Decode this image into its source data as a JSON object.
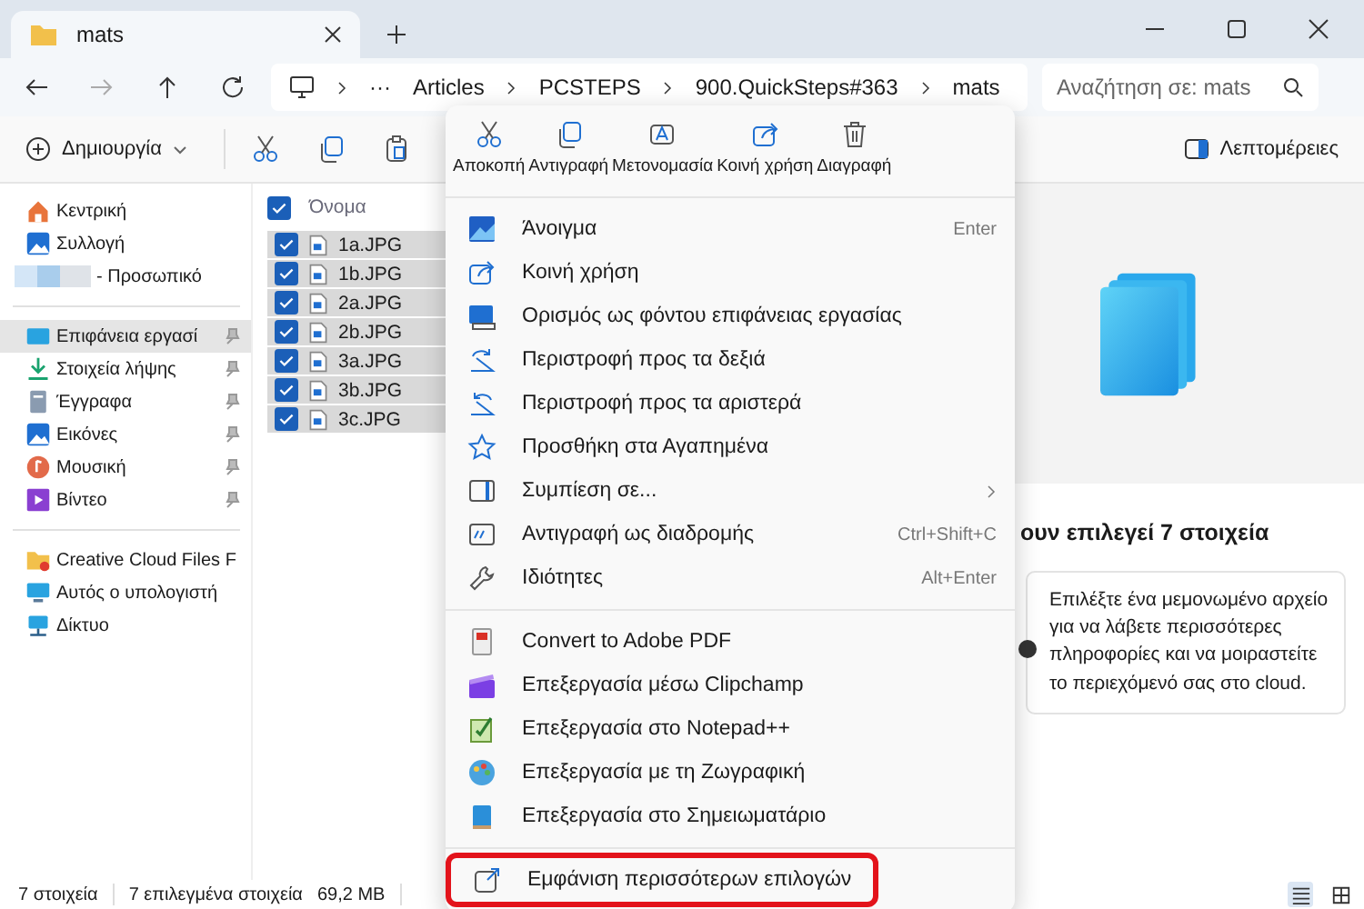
{
  "tabs": [
    {
      "title": "mats",
      "selected": true
    }
  ],
  "address": {
    "overflow": "···",
    "crumbs": [
      "Articles",
      "PCSTEPS",
      "900.QuickSteps#363",
      "mats"
    ]
  },
  "search": {
    "placeholder": "Αναζήτηση σε: mats"
  },
  "toolbar": {
    "new": "Δημιουργία",
    "details": "Λεπτομέρειες"
  },
  "sidebar": {
    "groups": [
      [
        {
          "label": "Κεντρική",
          "kind": "location",
          "pinned": false,
          "selected": false
        },
        {
          "label": "Συλλογή",
          "kind": "location",
          "pinned": false,
          "selected": false
        },
        {
          "label": "- Προσωπικό",
          "kind": "account",
          "pinned": false,
          "selected": false
        }
      ],
      [
        {
          "label": "Επιφάνεια εργασί",
          "kind": "location",
          "pinned": true,
          "selected": true
        },
        {
          "label": "Στοιχεία λήψης",
          "kind": "location",
          "pinned": true,
          "selected": false
        },
        {
          "label": "Έγγραφα",
          "kind": "location",
          "pinned": true,
          "selected": false
        },
        {
          "label": "Εικόνες",
          "kind": "location",
          "pinned": true,
          "selected": false
        },
        {
          "label": "Μουσική",
          "kind": "location",
          "pinned": true,
          "selected": false
        },
        {
          "label": "Βίντεο",
          "kind": "location",
          "pinned": true,
          "selected": false
        }
      ],
      [
        {
          "label": "Creative Cloud Files F",
          "kind": "location",
          "pinned": false,
          "selected": false
        },
        {
          "label": "Αυτός ο υπολογιστή",
          "kind": "location",
          "pinned": false,
          "selected": false
        },
        {
          "label": "Δίκτυο",
          "kind": "location",
          "pinned": false,
          "selected": false
        }
      ]
    ]
  },
  "files": {
    "header": "Όνομα",
    "header_checked": true,
    "rows": [
      {
        "name": "1a.JPG",
        "checked": true,
        "selected": true
      },
      {
        "name": "1b.JPG",
        "checked": true,
        "selected": true
      },
      {
        "name": "2a.JPG",
        "checked": true,
        "selected": true
      },
      {
        "name": "2b.JPG",
        "checked": true,
        "selected": true
      },
      {
        "name": "3a.JPG",
        "checked": true,
        "selected": true
      },
      {
        "name": "3b.JPG",
        "checked": true,
        "selected": true
      },
      {
        "name": "3c.JPG",
        "checked": true,
        "selected": true
      }
    ]
  },
  "details": {
    "heading": "ουν επιλεγεί 7 στοιχεία",
    "info": "Επιλέξτε ένα μεμονωμένο αρχείο για να λάβετε περισσότερες πληροφορίες και να μοιραστείτε το περιεχόμενό σας στο cloud."
  },
  "status_bar": {
    "count": "7 στοιχεία",
    "selection": "7 επιλεγμένα στοιχεία",
    "size": "69,2 MB",
    "views": [
      {
        "selected": true
      },
      {
        "selected": false
      }
    ]
  },
  "context_menu": {
    "actions": [
      "Αποκοπή",
      "Αντιγραφή",
      "Μετονομασία",
      "Κοινή χρήση",
      "Διαγραφή"
    ],
    "sections": [
      [
        {
          "label": "Άνοιγμα",
          "shortcut": "Enter",
          "submenu": false
        },
        {
          "label": "Κοινή χρήση",
          "submenu": false
        },
        {
          "label": "Ορισμός ως φόντου επιφάνειας εργασίας",
          "submenu": false
        },
        {
          "label": "Περιστροφή προς τα δεξιά",
          "submenu": false
        },
        {
          "label": "Περιστροφή προς τα αριστερά",
          "submenu": false
        },
        {
          "label": "Προσθήκη στα Αγαπημένα",
          "submenu": false
        },
        {
          "label": "Συμπίεση σε...",
          "submenu": true
        },
        {
          "label": "Αντιγραφή ως διαδρομής",
          "shortcut": "Ctrl+Shift+C",
          "submenu": false
        },
        {
          "label": "Ιδιότητες",
          "shortcut": "Alt+Enter",
          "submenu": false
        }
      ],
      [
        {
          "label": "Convert to Adobe PDF",
          "submenu": false
        },
        {
          "label": "Επεξεργασία μέσω Clipchamp",
          "submenu": false
        },
        {
          "label": "Επεξεργασία στο Notepad++",
          "submenu": false
        },
        {
          "label": "Επεξεργασία με τη Ζωγραφική",
          "submenu": false
        },
        {
          "label": "Επεξεργασία στο Σημειωματάριο",
          "submenu": false
        }
      ]
    ],
    "more": {
      "label": "Εμφάνιση περισσότερων επιλογών",
      "highlighted": true
    }
  }
}
